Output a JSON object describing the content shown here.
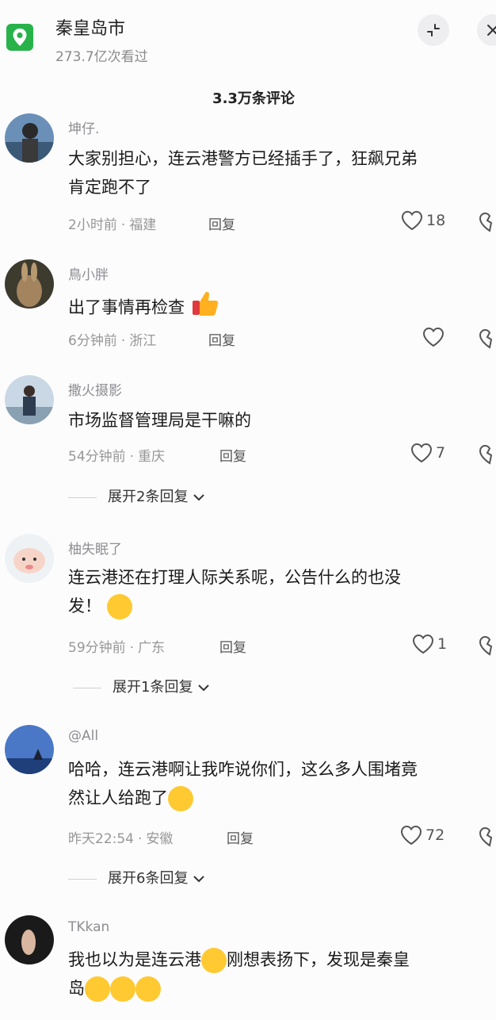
{
  "header": {
    "title": "秦皇岛市",
    "views": "273.7亿次看过"
  },
  "comment_count": "3.3万条评论",
  "reply_label": "回复",
  "comments": [
    {
      "user": "坤仔.",
      "text1": "大家别担心，连云港警方已经插手了，狂飙兄弟",
      "text2": "肯定跑不了",
      "time": "2小时前",
      "region": "福建",
      "likes": "18"
    },
    {
      "user": "鳥小胖",
      "text1": "出了事情再检查",
      "time": "6分钟前",
      "region": "浙江",
      "likes": ""
    },
    {
      "user": "撒火摄影",
      "text1": "市场监督管理局是干嘛的",
      "time": "54分钟前",
      "region": "重庆",
      "likes": "7",
      "expand": "展开2条回复"
    },
    {
      "user": "柚失眠了",
      "text1": "连云港还在打理人际关系呢，公告什么的也没",
      "text2": "发！",
      "time": "59分钟前",
      "region": "广东",
      "likes": "1",
      "expand": "展开1条回复"
    },
    {
      "user": "@All",
      "text1": "哈哈，连云港啊让我咋说你们，这么多人围堵竟",
      "text2": "然让人给跑了",
      "time": "昨天22:54",
      "region": "安徽",
      "likes": "72",
      "expand": "展开6条回复"
    },
    {
      "user": "TKkan",
      "text1a": "我也以为是连云港",
      "text1b": "刚想表扬下，发现是秦皇",
      "text2": "岛"
    }
  ]
}
